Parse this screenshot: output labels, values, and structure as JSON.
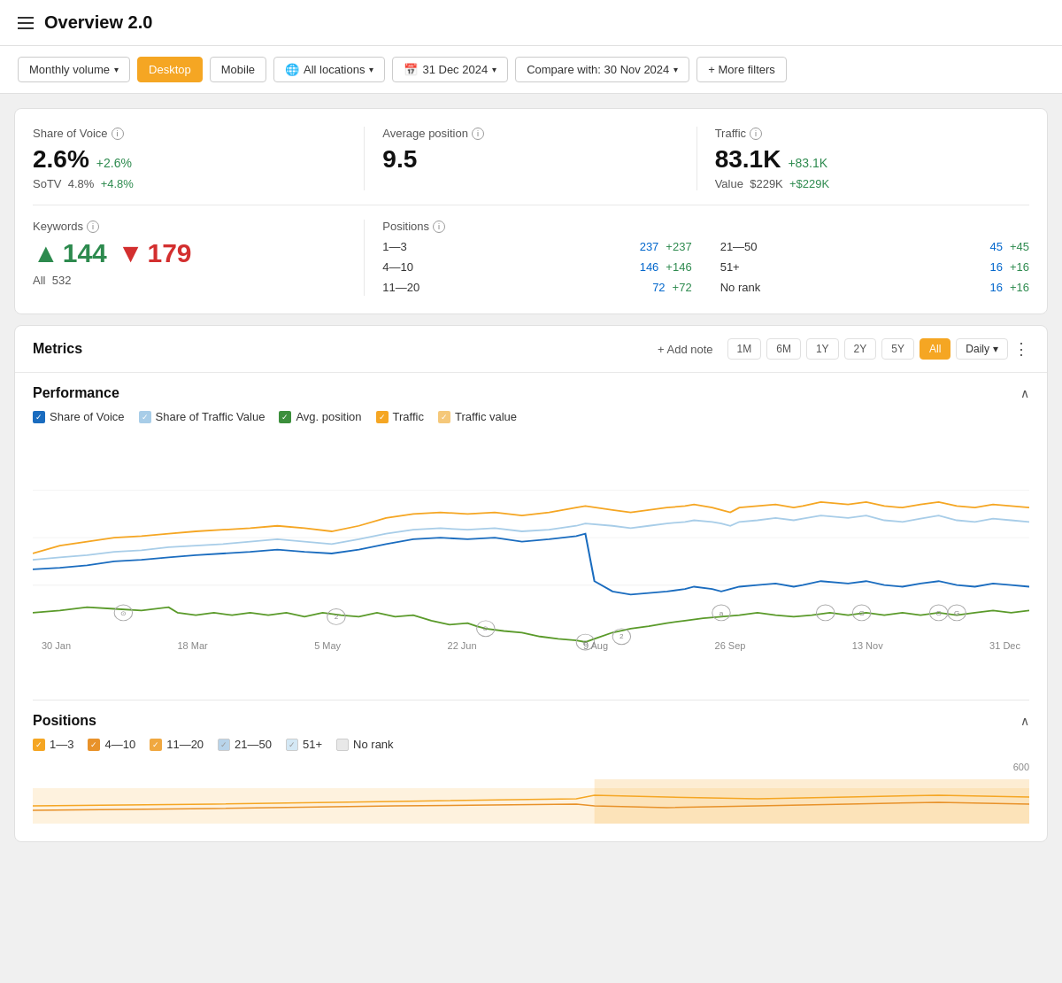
{
  "header": {
    "title": "Overview 2.0"
  },
  "toolbar": {
    "volume_label": "Monthly volume",
    "desktop_label": "Desktop",
    "mobile_label": "Mobile",
    "location_label": "All locations",
    "date_label": "31 Dec 2024",
    "compare_label": "Compare with: 30 Nov 2024",
    "more_filters_label": "+ More filters"
  },
  "stats": {
    "sov_label": "Share of Voice",
    "sov_value": "2.6%",
    "sov_change": "+2.6%",
    "sotv_label": "SoTV",
    "sotv_value": "4.8%",
    "sotv_change": "+4.8%",
    "avg_pos_label": "Average position",
    "avg_pos_value": "9.5",
    "traffic_label": "Traffic",
    "traffic_value": "83.1K",
    "traffic_change": "+83.1K",
    "value_label": "Value",
    "value_amount": "$229K",
    "value_change": "+$229K",
    "keywords_label": "Keywords",
    "keywords_up": "144",
    "keywords_down": "179",
    "keywords_all_label": "All",
    "keywords_all_value": "532",
    "positions_label": "Positions",
    "positions": [
      {
        "range": "1—3",
        "value": "237",
        "change": "+237"
      },
      {
        "range": "4—10",
        "value": "146",
        "change": "+146"
      },
      {
        "range": "11—20",
        "value": "72",
        "change": "+72"
      },
      {
        "range": "21—50",
        "value": "45",
        "change": "+45"
      },
      {
        "range": "51+",
        "value": "16",
        "change": "+16"
      },
      {
        "range": "No rank",
        "value": "16",
        "change": "+16"
      }
    ]
  },
  "metrics": {
    "section_label": "Metrics",
    "add_note_label": "+ Add note",
    "time_buttons": [
      "1M",
      "6M",
      "1Y",
      "2Y",
      "5Y",
      "All"
    ],
    "active_time": "All",
    "daily_label": "Daily"
  },
  "performance": {
    "title": "Performance",
    "legend": [
      {
        "label": "Share of Voice",
        "color": "blue"
      },
      {
        "label": "Share of Traffic Value",
        "color": "light-blue"
      },
      {
        "label": "Avg. position",
        "color": "green"
      },
      {
        "label": "Traffic",
        "color": "orange"
      },
      {
        "label": "Traffic value",
        "color": "light-orange"
      }
    ],
    "x_labels": [
      "30 Jan",
      "18 Mar",
      "5 May",
      "22 Jun",
      "9 Aug",
      "26 Sep",
      "13 Nov",
      "31 Dec"
    ]
  },
  "positions_section": {
    "title": "Positions",
    "legend": [
      {
        "label": "1—3",
        "color": "orange"
      },
      {
        "label": "4—10",
        "color": "orange2"
      },
      {
        "label": "11—20",
        "color": "orange3"
      },
      {
        "label": "21—50",
        "color": "blue-light"
      },
      {
        "label": "51+",
        "color": "blue-lighter"
      },
      {
        "label": "No rank",
        "color": "gray"
      }
    ],
    "y_label": "600"
  }
}
